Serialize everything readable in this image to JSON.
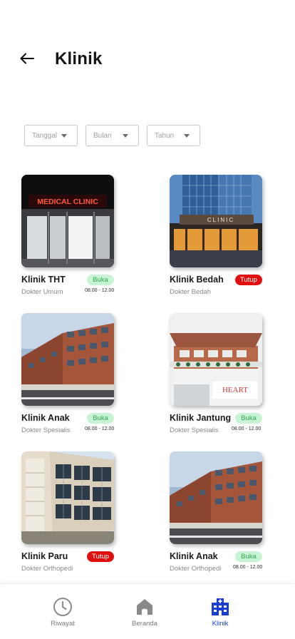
{
  "header": {
    "title": "Klinik"
  },
  "filters": [
    {
      "label": "Tanggal"
    },
    {
      "label": "Bulan"
    },
    {
      "label": "Tahun"
    }
  ],
  "clinics": [
    {
      "name": "Klinik THT",
      "doctor": "Dokter Umum",
      "status": "Buka",
      "status_type": "open",
      "hours": "08.00 - 12.00",
      "image": "medical-clinic-storefront",
      "sign_text": "MEDICAL CLINIC"
    },
    {
      "name": "Klinik Bedah",
      "doctor": "Dokter Bedah",
      "status": "Tutup",
      "status_type": "closed",
      "hours": "",
      "image": "glass-tower-clinic",
      "sign_text": "CLINIC"
    },
    {
      "name": "Klinik Anak",
      "doctor": "Dokter Spesialis",
      "status": "Buka",
      "status_type": "open",
      "hours": "08.00 - 12.00",
      "image": "brick-hospital-building"
    },
    {
      "name": "Klinik Jantung",
      "doctor": "Dokter Spesialis",
      "status": "Buka",
      "status_type": "open",
      "hours": "08.00 - 12.00",
      "image": "heart-center-building",
      "sign_text": "HEART"
    },
    {
      "name": "Klinik Paru",
      "doctor": "Dokter Orthopedi",
      "status": "Tutup",
      "status_type": "closed",
      "hours": "",
      "image": "modern-glass-facade"
    },
    {
      "name": "Klinik Anak",
      "doctor": "Dokter Orthopedi",
      "status": "Buka",
      "status_type": "open",
      "hours": "08.00 - 12.00",
      "image": "brick-hospital-building"
    }
  ],
  "nav": [
    {
      "label": "Riwayat",
      "icon": "clock-icon",
      "active": false
    },
    {
      "label": "Beranda",
      "icon": "home-icon",
      "active": false
    },
    {
      "label": "Klinik",
      "icon": "hospital-icon",
      "active": true
    }
  ],
  "colors": {
    "accent": "#1a3fd0",
    "open_bg": "#c9f3d5",
    "open_text": "#2ea84f",
    "closed_bg": "#e01010"
  }
}
